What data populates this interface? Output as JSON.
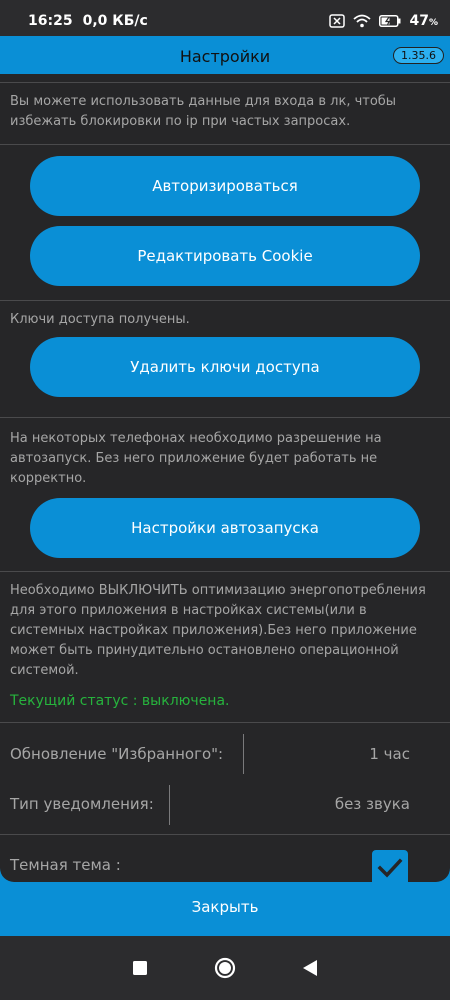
{
  "status_bar": {
    "time": "16:25",
    "speed": "0,0 КБ/с",
    "battery": "47",
    "battery_unit": "%"
  },
  "header": {
    "title": "Настройки",
    "version": "1.35.6"
  },
  "main": {
    "intro_text": "Вы можете использовать данные для входа в лк, чтобы избежать блокировки по ip при частых запросах.",
    "authorize_label": "Авторизироваться",
    "edit_cookie_label": "Редактировать Cookie",
    "keys_status": "Ключи доступа получены.",
    "delete_keys_label": "Удалить ключи доступа",
    "autostart_text": "На некоторых телефонах необходимо разрешение на автозапуск. Без него приложение будет работать не корректно.",
    "autostart_label": "Настройки автозапуска",
    "battery_text": "Необходимо ВЫКЛЮЧИТЬ оптимизацию энергопотребления для этого приложения в настройках системы(или в системных настройках приложения).Без него приложение может быть принудительно остановлено операционной системой.",
    "current_status": "Текущий статус : выключена.",
    "favorites_update_label": "Обновление \"Избранного\":",
    "favorites_update_value": "1 час",
    "notification_type_label": "Тип уведомления:",
    "notification_type_value": "без звука",
    "dark_theme_label": "Темная тема :",
    "dark_theme_checked": true
  },
  "footer": {
    "close_label": "Закрыть"
  },
  "colors": {
    "accent": "#0a8fd6",
    "background": "#262628",
    "status_ok": "#26b33d"
  }
}
